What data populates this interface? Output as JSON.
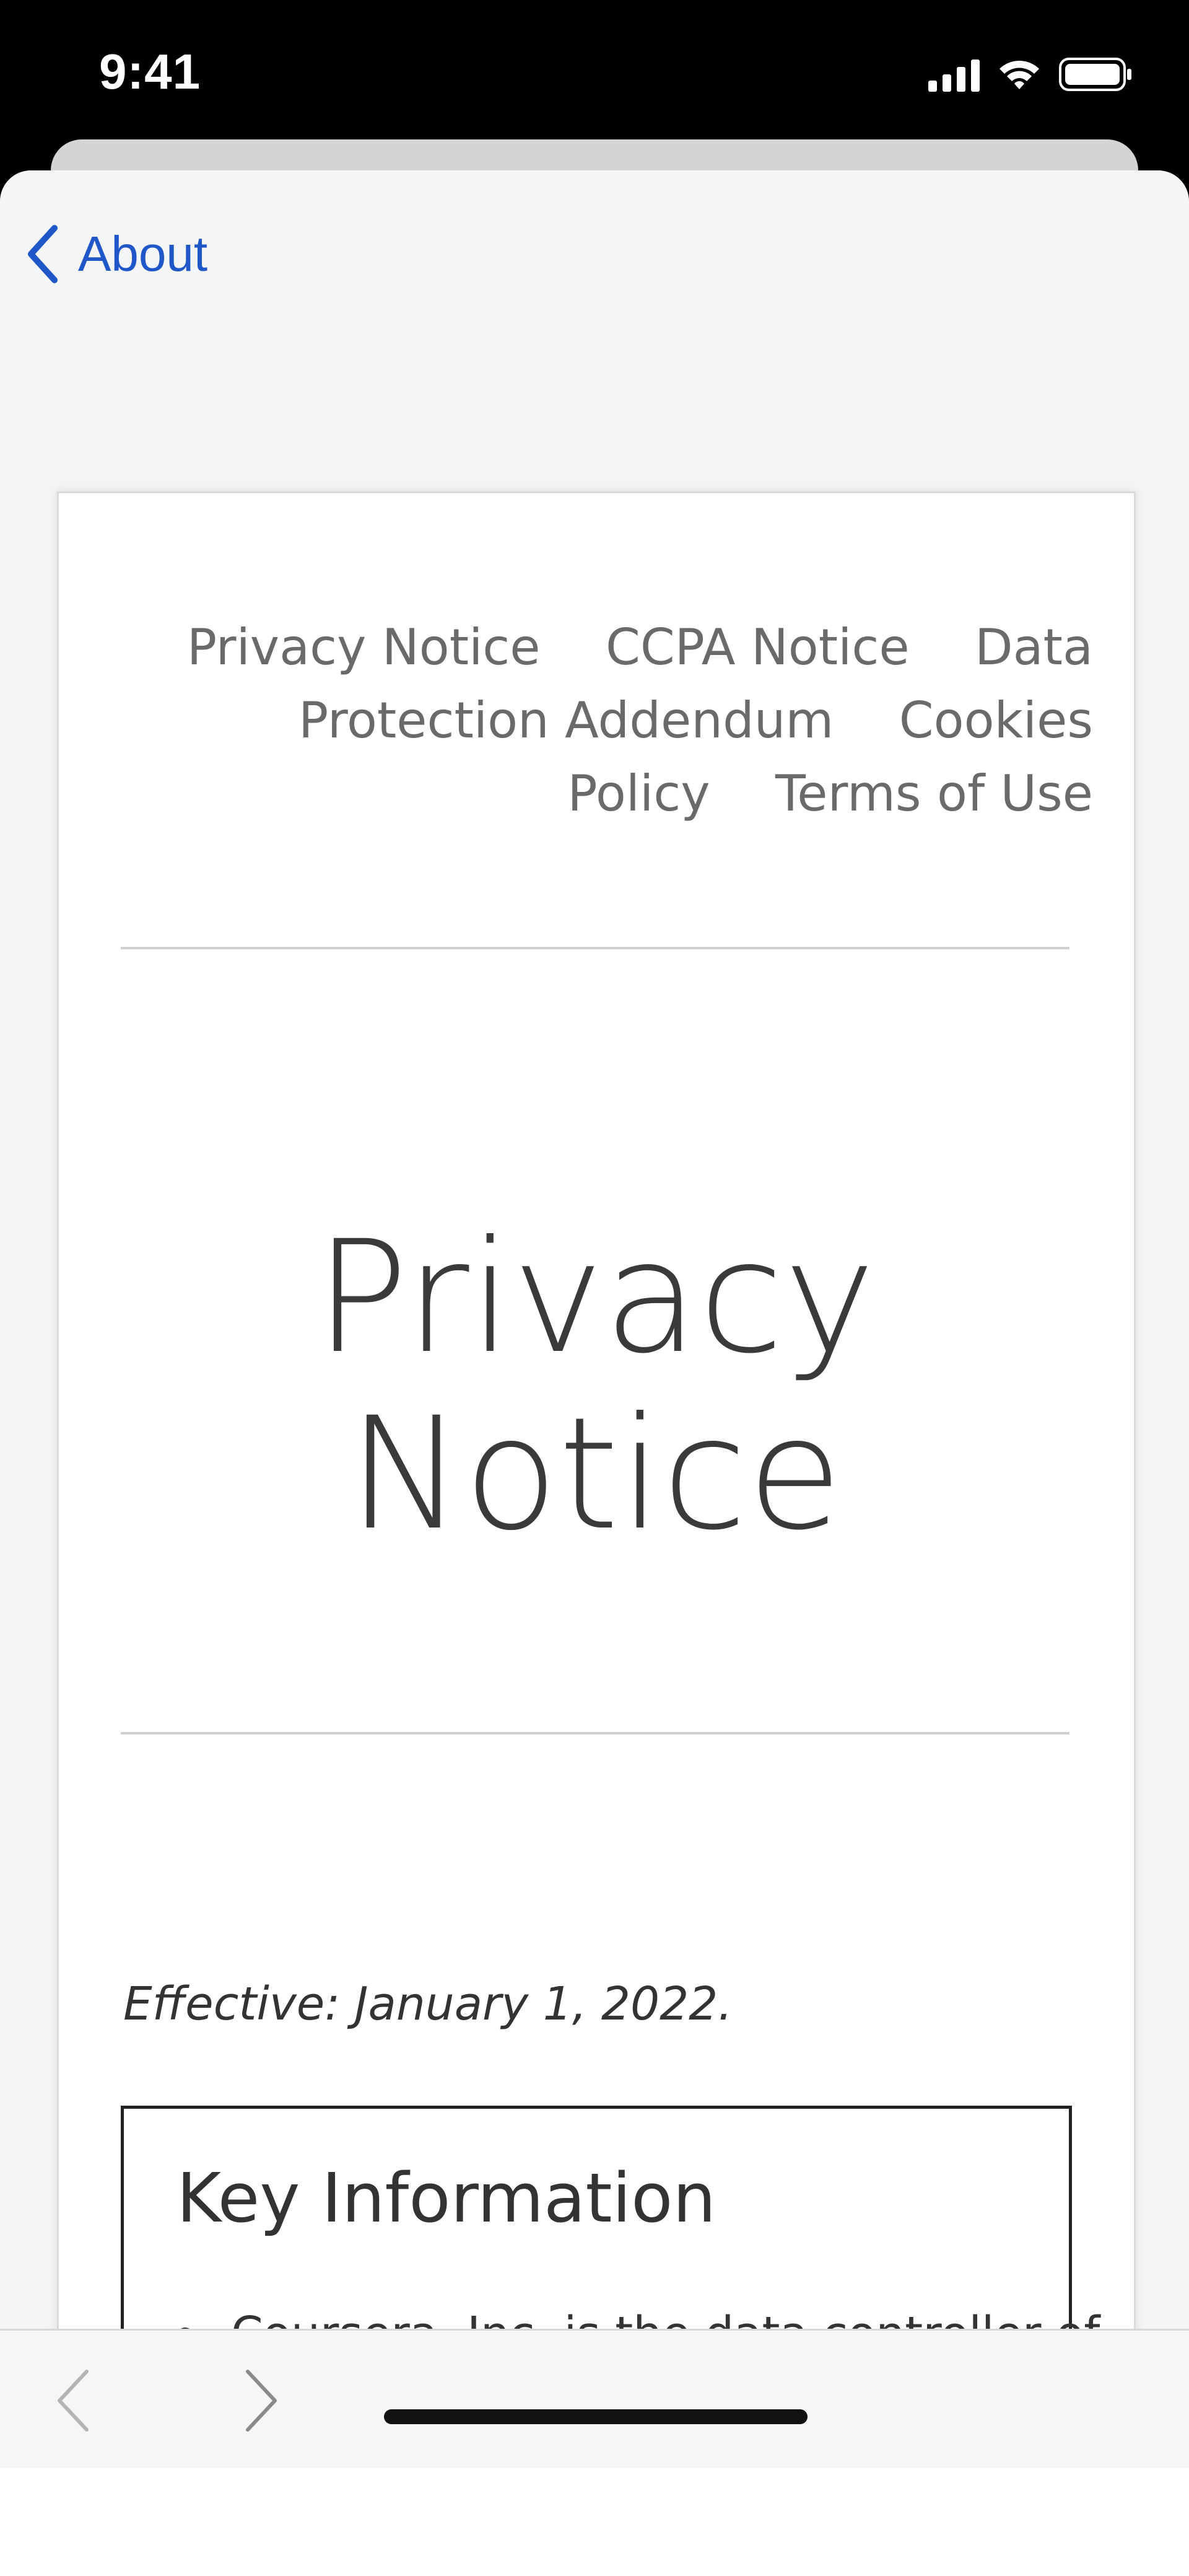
{
  "status_bar": {
    "time": "9:41"
  },
  "nav": {
    "back_label": "About"
  },
  "page": {
    "top_links": [
      "Privacy Notice",
      "CCPA Notice",
      "Data Protection Addendum",
      "Cookies Policy",
      "Terms of Use"
    ],
    "title": "Privacy Notice",
    "effective": "Effective: January 1, 2022.",
    "key_info": {
      "heading": "Key Information",
      "first_item": "Coursera, Inc. is the data controller of"
    }
  },
  "colors": {
    "link_blue": "#1f56c8",
    "sheet_bg": "#f4f4f5",
    "text_gray": "#6a6a6a"
  },
  "icons": {
    "back": "chevron-left-icon",
    "toolbar_back": "chevron-left-icon",
    "toolbar_forward": "chevron-right-icon"
  }
}
